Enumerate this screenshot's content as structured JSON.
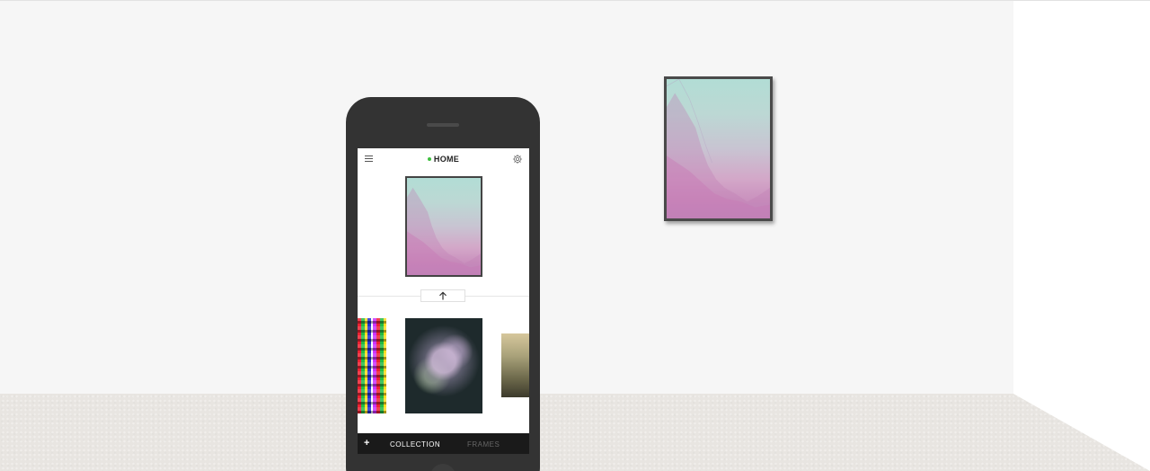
{
  "scene": {
    "colors": {
      "wall": "#f6f6f6",
      "side_wall": "#ffffff",
      "floor": "#e8e5e1",
      "phone": "#333333",
      "status_dot": "#3fbf3f"
    }
  },
  "wall_artwork": {
    "icon": "artwork-mountain-gradient"
  },
  "phone": {
    "header": {
      "title": "HOME",
      "menu_icon": "hamburger-icon",
      "settings_icon": "gear-icon",
      "status": "connected"
    },
    "current_artwork": {
      "icon": "artwork-mountain-gradient"
    },
    "upload_button_icon": "arrow-up-icon",
    "thumbnails": [
      {
        "icon": "artwork-colorful-mosaic"
      },
      {
        "icon": "artwork-floral-cluster"
      },
      {
        "icon": "artwork-golden-horizon"
      }
    ],
    "bottom_bar": {
      "add_label": "+",
      "tabs": [
        {
          "label": "COLLECTION",
          "active": true
        },
        {
          "label": "FRAMES",
          "active": false
        }
      ]
    }
  }
}
